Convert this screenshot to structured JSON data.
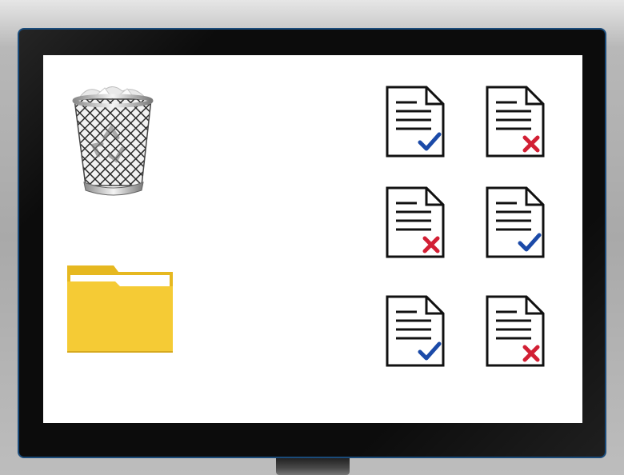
{
  "desktop": {
    "icons": [
      {
        "name": "recycle-bin",
        "icon": "recycle-bin-icon"
      },
      {
        "name": "folder",
        "icon": "folder-icon",
        "color": "#F5CB35"
      }
    ],
    "documents": [
      {
        "status": "approved",
        "mark": "checkmark",
        "mark_color": "#1B4AA8"
      },
      {
        "status": "rejected",
        "mark": "x",
        "mark_color": "#D21F34"
      },
      {
        "status": "rejected",
        "mark": "x",
        "mark_color": "#D21F34"
      },
      {
        "status": "approved",
        "mark": "checkmark",
        "mark_color": "#1B4AA8"
      },
      {
        "status": "approved",
        "mark": "checkmark",
        "mark_color": "#1B4AA8"
      },
      {
        "status": "rejected",
        "mark": "x",
        "mark_color": "#D21F34"
      }
    ]
  },
  "colors": {
    "bezel": "#0C0C0C",
    "bezel_edge": "#1A4B7A",
    "screen": "#FFFFFF",
    "background": "#A9A9A9"
  }
}
